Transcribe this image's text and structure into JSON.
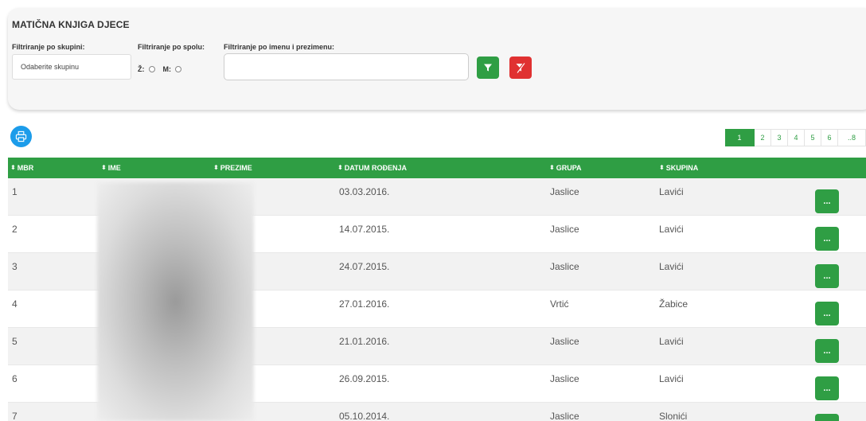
{
  "filters": {
    "title": "MATIČNA KNJIGA DJECE",
    "group_label": "Filtriranje po skupini:",
    "group_selected": "Odaberite skupinu",
    "gender_label": "Filtriranje po spolu:",
    "gender_options": [
      "Ž:",
      "M:"
    ],
    "name_label": "Filtriranje po imenu i prezimenu:",
    "name_value": ""
  },
  "pagination": {
    "pages": [
      "1",
      "2",
      "3",
      "4",
      "5",
      "6",
      "..8"
    ],
    "active": "1"
  },
  "table": {
    "headers": [
      "MBR",
      "IME",
      "PREZIME",
      "DATUM ROĐENJA",
      "GRUPA",
      "SKUPINA"
    ],
    "action_label": "...",
    "rows": [
      {
        "mbr": "1",
        "datum": "03.03.2016.",
        "grupa": "Jaslice",
        "skupina": "Lavići"
      },
      {
        "mbr": "2",
        "datum": "14.07.2015.",
        "grupa": "Jaslice",
        "skupina": "Lavići"
      },
      {
        "mbr": "3",
        "datum": "24.07.2015.",
        "grupa": "Jaslice",
        "skupina": "Lavići"
      },
      {
        "mbr": "4",
        "datum": "27.01.2016.",
        "grupa": "Vrtić",
        "skupina": "Žabice"
      },
      {
        "mbr": "5",
        "datum": "21.01.2016.",
        "grupa": "Jaslice",
        "skupina": "Lavići"
      },
      {
        "mbr": "6",
        "datum": "26.09.2015.",
        "grupa": "Jaslice",
        "skupina": "Lavići"
      },
      {
        "mbr": "7",
        "datum": "05.10.2014.",
        "grupa": "Jaslice",
        "skupina": "Slonići"
      }
    ]
  },
  "colors": {
    "primary_green": "#2f9e44",
    "danger_red": "#e03131",
    "print_blue": "#1c9cea"
  },
  "icons": {
    "filter": "filter-icon",
    "clear_filter": "filter-clear-icon",
    "print": "printer-icon",
    "sort": "sort-icon",
    "more": "more-icon"
  }
}
